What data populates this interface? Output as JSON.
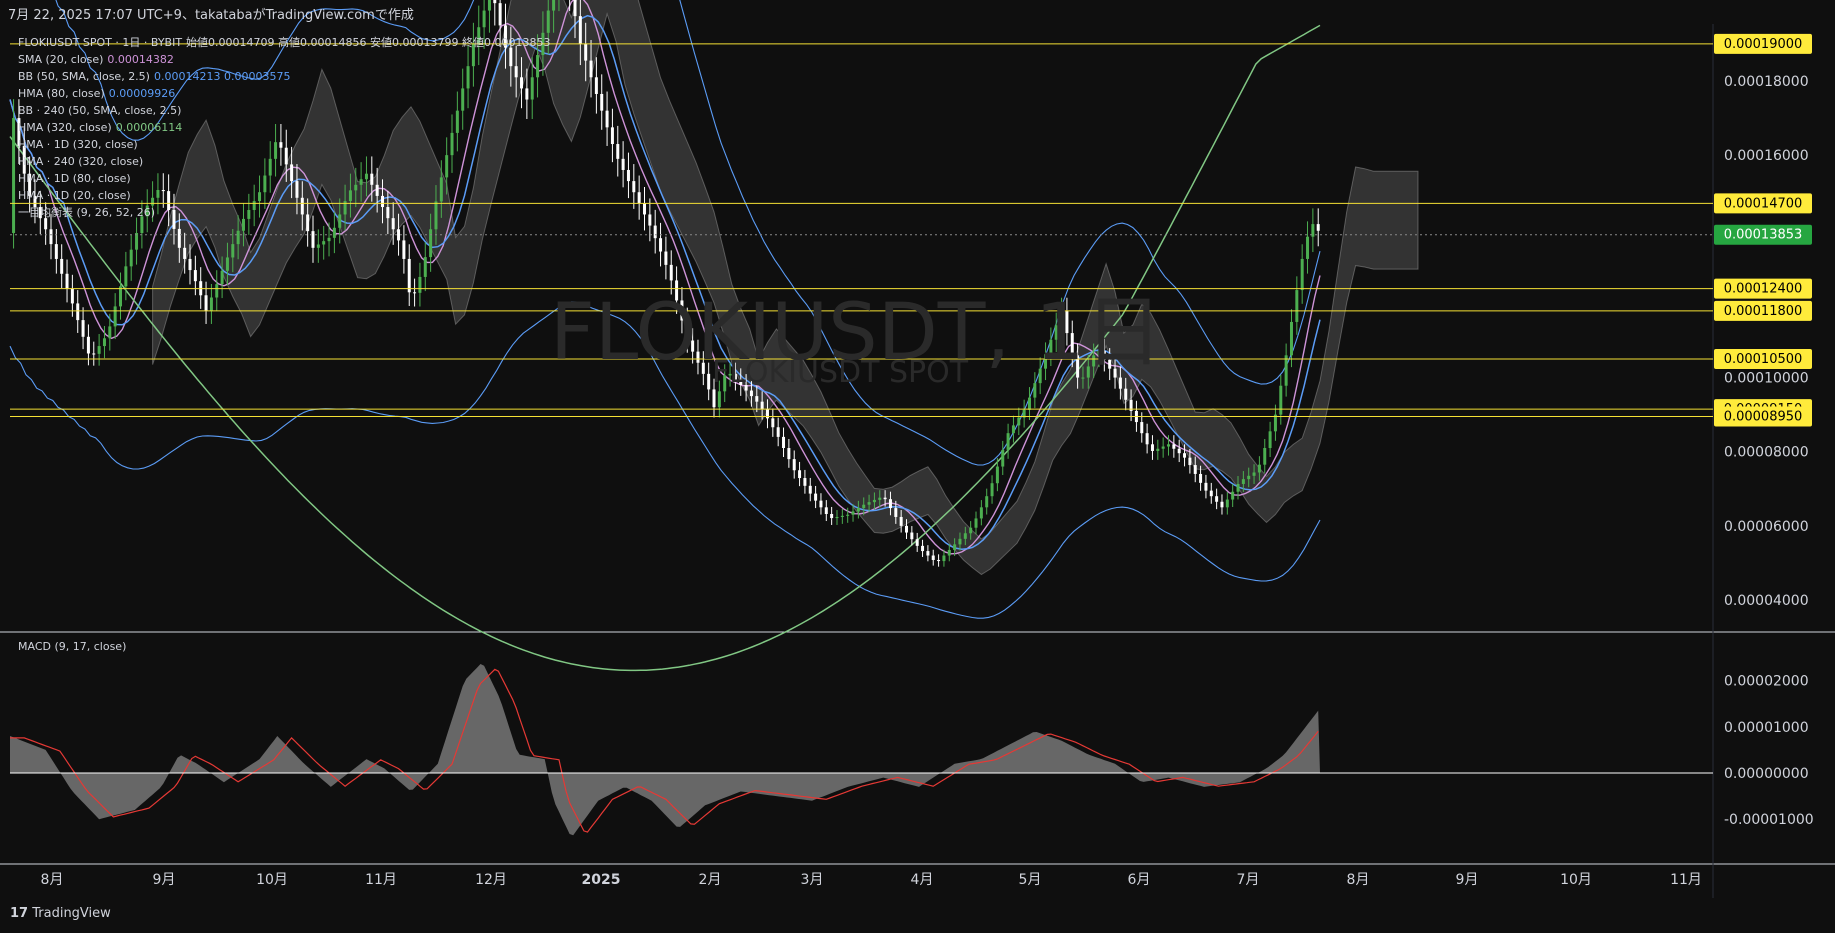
{
  "header": {
    "timestamp": "7月 22, 2025 17:07 UTC+9、takatabaがTradingView.comで作成"
  },
  "legend": [
    {
      "label": "FLOKIUSDT SPOT · 1日 · BYBIT",
      "value": "始値0.00014709 高値0.00014856 安値0.00013799 終値0.00013853",
      "color": "#d1d4dc"
    },
    {
      "label": "SMA (20, close)",
      "value": "0.00014382",
      "color": "#ce93d8"
    },
    {
      "label": "BB (50, SMA, close, 2.5)",
      "value": "0.00014213 0.00003575",
      "color": "#5b9cf6"
    },
    {
      "label": "HMA (80, close)",
      "value": "0.00009926",
      "color": "#5b9cf6"
    },
    {
      "label": "BB · 240 (50, SMA, close, 2.5)",
      "value": "",
      "color": "#d1d4dc"
    },
    {
      "label": "HMA (320, close)",
      "value": "0.00006114",
      "color": "#81c784"
    },
    {
      "label": "HMA · 1D (320, close)",
      "value": "",
      "color": "#d1d4dc"
    },
    {
      "label": "HMA · 240 (320, close)",
      "value": "",
      "color": "#d1d4dc"
    },
    {
      "label": "HMA · 1D (80, close)",
      "value": "",
      "color": "#d1d4dc"
    },
    {
      "label": "HMA · 1D (20, close)",
      "value": "",
      "color": "#d1d4dc"
    },
    {
      "label": "一目均衡表 (9, 26, 52, 26)",
      "value": "",
      "color": "#d1d4dc"
    }
  ],
  "watermark": {
    "symbol": "FLOKIUSDT, 1日",
    "sub": "FLOKIUSDT SPOT"
  },
  "macd_label": "MACD (9, 17, close)",
  "footer": {
    "brand": "TradingView"
  },
  "colors": {
    "background": "#0f0f0f",
    "up": "#4caf50",
    "down": "#ffffff",
    "level_line": "#f5e135",
    "level_label_bg": "#ffeb3b",
    "last_price_bg": "#26a641",
    "sma": "#ce93d8",
    "bb": "#5b9cf6",
    "hma320": "#81c784",
    "macd_signal": "#e53935",
    "histogram": "#777777"
  },
  "chart_data": {
    "type": "candlestick",
    "symbol": "FLOKIUSDT SPOT · 1日 · BYBIT",
    "x_ticks": [
      "8月",
      "9月",
      "10月",
      "11月",
      "12月",
      "2025",
      "2月",
      "3月",
      "4月",
      "5月",
      "6月",
      "7月",
      "8月",
      "9月",
      "10月",
      "11月"
    ],
    "y_ticks": [
      "0.00018000",
      "0.00016000",
      "0.00010000",
      "0.00008000",
      "0.00006000",
      "0.00004000"
    ],
    "y_tick_values": [
      0.00018,
      0.00016,
      0.0001,
      8e-05,
      6e-05,
      4e-05
    ],
    "horizontal_levels": [
      "0.00019000",
      "0.00014700",
      "0.00012400",
      "0.00011800",
      "0.00010500",
      "0.00009150",
      "0.00008950"
    ],
    "horizontal_level_values": [
      0.00019,
      0.000147,
      0.000124,
      0.000118,
      0.000105,
      9.15e-05,
      8.95e-05
    ],
    "last_price": "0.00013853",
    "last_price_value": 0.00013853,
    "ohlc_last": {
      "open": 0.00014709,
      "high": 0.00014856,
      "low": 0.00013799,
      "close": 0.00013853
    },
    "price_path": [
      [
        0,
        0.000175
      ],
      [
        10,
        0.00015
      ],
      [
        20,
        0.00014
      ],
      [
        35,
        0.00012
      ],
      [
        45,
        0.000105
      ],
      [
        55,
        0.000112
      ],
      [
        65,
        0.00013
      ],
      [
        75,
        0.000145
      ],
      [
        85,
        0.000152
      ],
      [
        95,
        0.000135
      ],
      [
        105,
        0.000125
      ],
      [
        110,
        0.000118
      ],
      [
        120,
        0.00013
      ],
      [
        130,
        0.000142
      ],
      [
        140,
        0.00015
      ],
      [
        150,
        0.000165
      ],
      [
        160,
        0.00015
      ],
      [
        170,
        0.000135
      ],
      [
        180,
        0.000138
      ],
      [
        190,
        0.00015
      ],
      [
        200,
        0.000155
      ],
      [
        210,
        0.000145
      ],
      [
        220,
        0.000135
      ],
      [
        225,
        0.00012
      ],
      [
        232,
        0.00013
      ],
      [
        240,
        0.00015
      ],
      [
        250,
        0.00017
      ],
      [
        260,
        0.00019
      ],
      [
        270,
        0.000205
      ],
      [
        280,
        0.000185
      ],
      [
        290,
        0.000175
      ],
      [
        300,
        0.000195
      ],
      [
        310,
        0.000215
      ],
      [
        320,
        0.00019
      ],
      [
        330,
        0.000175
      ],
      [
        340,
        0.00016
      ],
      [
        350,
        0.00015
      ],
      [
        360,
        0.00014
      ],
      [
        370,
        0.000128
      ],
      [
        380,
        0.00011
      ],
      [
        390,
        0.0001
      ],
      [
        395,
        9.2e-05
      ],
      [
        402,
        0.000102
      ],
      [
        410,
        9.8e-05
      ],
      [
        420,
        9.3e-05
      ],
      [
        430,
        8.5e-05
      ],
      [
        440,
        7.5e-05
      ],
      [
        450,
        6.8e-05
      ],
      [
        460,
        6.2e-05
      ],
      [
        470,
        6.3e-05
      ],
      [
        480,
        6.6e-05
      ],
      [
        490,
        6.8e-05
      ],
      [
        500,
        6e-05
      ],
      [
        510,
        5.4e-05
      ],
      [
        520,
        5e-05
      ],
      [
        530,
        5.5e-05
      ],
      [
        540,
        6e-05
      ],
      [
        550,
        7e-05
      ],
      [
        560,
        8.5e-05
      ],
      [
        570,
        9.2e-05
      ],
      [
        580,
        0.000105
      ],
      [
        590,
        0.000118
      ],
      [
        600,
        9.8e-05
      ],
      [
        610,
        0.000108
      ],
      [
        620,
        0.0001
      ],
      [
        630,
        9e-05
      ],
      [
        640,
        8e-05
      ],
      [
        650,
        8.2e-05
      ],
      [
        660,
        7.8e-05
      ],
      [
        670,
        7e-05
      ],
      [
        680,
        6.5e-05
      ],
      [
        690,
        7.2e-05
      ],
      [
        700,
        7.5e-05
      ],
      [
        710,
        9e-05
      ],
      [
        715,
        0.000103
      ],
      [
        720,
        0.000118
      ],
      [
        725,
        0.000132
      ],
      [
        730,
        0.000142
      ],
      [
        735,
        0.000139
      ]
    ],
    "macd": {
      "label": "MACD (9, 17, close)",
      "y_ticks": [
        "0.00002000",
        "0.00001000",
        "0.00000000",
        "-0.00001000"
      ],
      "y_tick_values": [
        2e-05,
        1e-05,
        0,
        -1e-05
      ],
      "histogram": [
        [
          0,
          8e-06
        ],
        [
          20,
          5e-06
        ],
        [
          35,
          -4e-06
        ],
        [
          50,
          -1e-05
        ],
        [
          70,
          -8e-06
        ],
        [
          85,
          -3e-06
        ],
        [
          95,
          4e-06
        ],
        [
          105,
          2e-06
        ],
        [
          120,
          -2e-06
        ],
        [
          140,
          3e-06
        ],
        [
          150,
          8e-06
        ],
        [
          165,
          2e-06
        ],
        [
          180,
          -3e-06
        ],
        [
          200,
          3e-06
        ],
        [
          210,
          1e-06
        ],
        [
          225,
          -4e-06
        ],
        [
          240,
          2e-06
        ],
        [
          255,
          2e-05
        ],
        [
          265,
          2.4e-05
        ],
        [
          275,
          1.6e-05
        ],
        [
          285,
          4e-06
        ],
        [
          300,
          3e-06
        ],
        [
          305,
          -6e-06
        ],
        [
          315,
          -1.4e-05
        ],
        [
          330,
          -6e-06
        ],
        [
          345,
          -3e-06
        ],
        [
          360,
          -6e-06
        ],
        [
          375,
          -1.2e-05
        ],
        [
          390,
          -7e-06
        ],
        [
          410,
          -4e-06
        ],
        [
          430,
          -5e-06
        ],
        [
          450,
          -6e-06
        ],
        [
          470,
          -3e-06
        ],
        [
          490,
          -1e-06
        ],
        [
          510,
          -3e-06
        ],
        [
          530,
          2e-06
        ],
        [
          545,
          3e-06
        ],
        [
          560,
          6e-06
        ],
        [
          575,
          9e-06
        ],
        [
          590,
          7e-06
        ],
        [
          605,
          4e-06
        ],
        [
          620,
          2e-06
        ],
        [
          635,
          -2e-06
        ],
        [
          650,
          -1e-06
        ],
        [
          670,
          -3e-06
        ],
        [
          690,
          -2e-06
        ],
        [
          705,
          1e-06
        ],
        [
          715,
          4e-06
        ],
        [
          725,
          9e-06
        ],
        [
          735,
          1.4e-05
        ]
      ]
    }
  }
}
